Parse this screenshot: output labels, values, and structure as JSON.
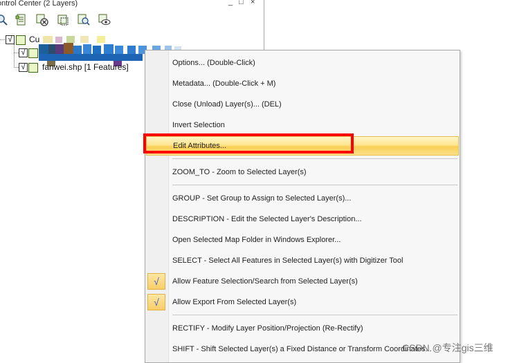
{
  "panel": {
    "title": "ontrol Center (2 Layers)",
    "window_buttons": {
      "minimize": "_",
      "maximize": "□",
      "close": "×"
    },
    "toolbar_icons": [
      "zoom-layer-icon",
      "layer-list-icon",
      "remove-layer-icon",
      "select-layer-icon",
      "search-layer-icon",
      "view-layer-icon"
    ]
  },
  "tree": {
    "root_label": "Cu",
    "children": [
      {
        "label": ""
      },
      {
        "label": "fanwei.shp [1 Features]"
      }
    ]
  },
  "menu": {
    "items": [
      {
        "label": "Options... (Double-Click)"
      },
      {
        "label": "Metadata... (Double-Click + M)"
      },
      {
        "label": "Close (Unload) Layer(s)... (DEL)"
      },
      {
        "label": "Invert Selection"
      },
      {
        "label": "Edit Attributes..."
      },
      {
        "label": "ZOOM_TO - Zoom to Selected Layer(s)"
      },
      {
        "label": "GROUP - Set Group to Assign to Selected Layer(s)..."
      },
      {
        "label": "DESCRIPTION - Edit the Selected Layer's Description..."
      },
      {
        "label": "Open Selected Map Folder in Windows Explorer..."
      },
      {
        "label": "SELECT - Select All Features in Selected Layer(s) with Digitizer Tool"
      },
      {
        "label": "Allow Feature Selection/Search from Selected Layer(s)",
        "checked": true
      },
      {
        "label": "Allow Export From Selected Layer(s)",
        "checked": true
      },
      {
        "label": "RECTIFY - Modify Layer Position/Projection (Re-Rectify)"
      },
      {
        "label": "SHIFT - Shift Selected Layer(s) a Fixed Distance or Transform Coordinates..."
      }
    ],
    "check_glyph": "√"
  },
  "watermark": "CSDN @专注gis三维",
  "colors": {
    "highlight": "#f8cf54",
    "annotation_box": "#ff0000",
    "check_mark": "#3b5bc8"
  }
}
